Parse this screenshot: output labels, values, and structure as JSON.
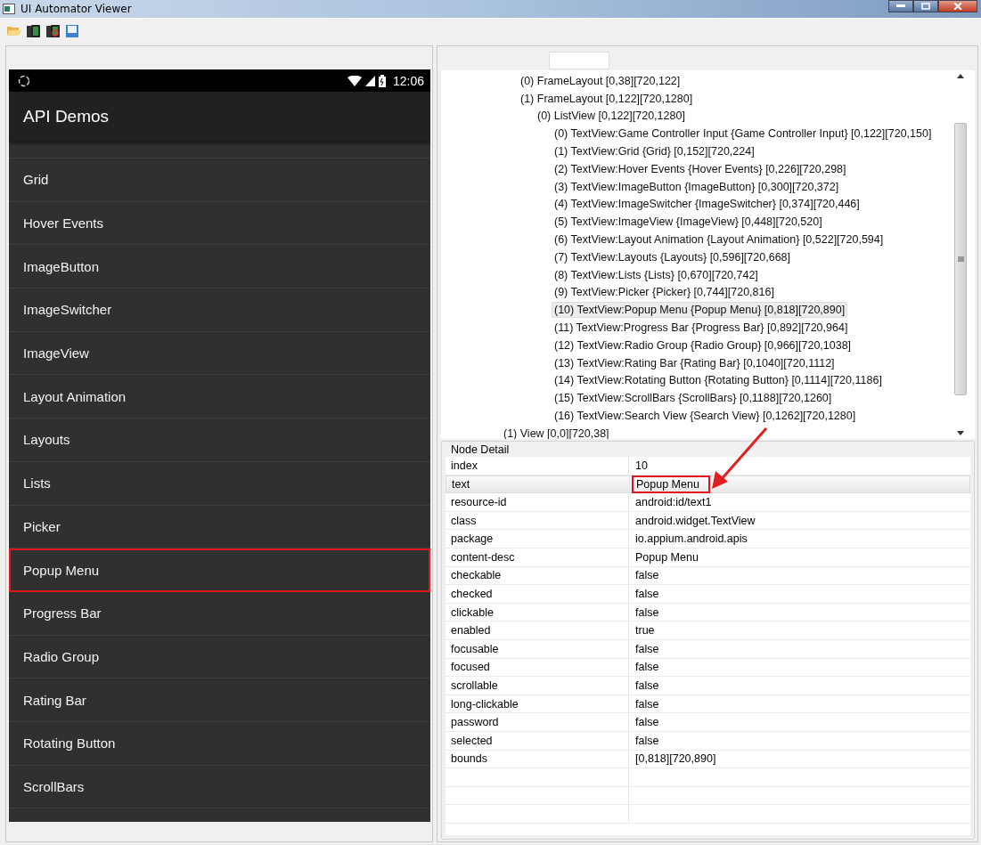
{
  "window": {
    "title": "UI Automator Viewer"
  },
  "device": {
    "time": "12:06",
    "app_title": "API Demos",
    "items": [
      {
        "label": "Grid",
        "selected": false
      },
      {
        "label": "Hover Events",
        "selected": false
      },
      {
        "label": "ImageButton",
        "selected": false
      },
      {
        "label": "ImageSwitcher",
        "selected": false
      },
      {
        "label": "ImageView",
        "selected": false
      },
      {
        "label": "Layout Animation",
        "selected": false
      },
      {
        "label": "Layouts",
        "selected": false
      },
      {
        "label": "Lists",
        "selected": false
      },
      {
        "label": "Picker",
        "selected": false
      },
      {
        "label": "Popup Menu",
        "selected": true
      },
      {
        "label": "Progress Bar",
        "selected": false
      },
      {
        "label": "Radio Group",
        "selected": false
      },
      {
        "label": "Rating Bar",
        "selected": false
      },
      {
        "label": "Rotating Button",
        "selected": false
      },
      {
        "label": "ScrollBars",
        "selected": false
      }
    ]
  },
  "tree": [
    {
      "children": [
        {
          "label": "(0) FrameLayout [0,38][720,122]",
          "selected": false
        },
        {
          "label": "(1) FrameLayout [0,122][720,1280]",
          "selected": false,
          "children": [
            {
              "label": "(0) ListView [0,122][720,1280]",
              "selected": false,
              "children": [
                {
                  "label": "(0) TextView:Game Controller Input {Game Controller Input} [0,122][720,150]",
                  "selected": false
                },
                {
                  "label": "(1) TextView:Grid {Grid} [0,152][720,224]",
                  "selected": false
                },
                {
                  "label": "(2) TextView:Hover Events {Hover Events} [0,226][720,298]",
                  "selected": false
                },
                {
                  "label": "(3) TextView:ImageButton {ImageButton} [0,300][720,372]",
                  "selected": false
                },
                {
                  "label": "(4) TextView:ImageSwitcher {ImageSwitcher} [0,374][720,446]",
                  "selected": false
                },
                {
                  "label": "(5) TextView:ImageView {ImageView} [0,448][720,520]",
                  "selected": false
                },
                {
                  "label": "(6) TextView:Layout Animation {Layout Animation} [0,522][720,594]",
                  "selected": false
                },
                {
                  "label": "(7) TextView:Layouts {Layouts} [0,596][720,668]",
                  "selected": false
                },
                {
                  "label": "(8) TextView:Lists {Lists} [0,670][720,742]",
                  "selected": false
                },
                {
                  "label": "(9) TextView:Picker {Picker} [0,744][720,816]",
                  "selected": false
                },
                {
                  "label": "(10) TextView:Popup Menu {Popup Menu} [0,818][720,890]",
                  "selected": true
                },
                {
                  "label": "(11) TextView:Progress Bar {Progress Bar} [0,892][720,964]",
                  "selected": false
                },
                {
                  "label": "(12) TextView:Radio Group {Radio Group} [0,966][720,1038]",
                  "selected": false
                },
                {
                  "label": "(13) TextView:Rating Bar {Rating Bar} [0,1040][720,1112]",
                  "selected": false
                },
                {
                  "label": "(14) TextView:Rotating Button {Rotating Button} [0,1114][720,1186]",
                  "selected": false
                },
                {
                  "label": "(15) TextView:ScrollBars {ScrollBars} [0,1188][720,1260]",
                  "selected": false
                },
                {
                  "label": "(16) TextView:Search View {Search View} [0,1262][720,1280]",
                  "selected": false
                }
              ]
            }
          ]
        }
      ]
    },
    {
      "label": "(1) View [0,0][720,38]",
      "selected": false
    }
  ],
  "node_detail": {
    "title": "Node Detail",
    "rows": [
      {
        "key": "index",
        "value": "10",
        "selected": false
      },
      {
        "key": "text",
        "value": "Popup Menu",
        "selected": true
      },
      {
        "key": "resource-id",
        "value": "android:id/text1",
        "selected": false
      },
      {
        "key": "class",
        "value": "android.widget.TextView",
        "selected": false
      },
      {
        "key": "package",
        "value": "io.appium.android.apis",
        "selected": false
      },
      {
        "key": "content-desc",
        "value": "Popup Menu",
        "selected": false
      },
      {
        "key": "checkable",
        "value": "false",
        "selected": false
      },
      {
        "key": "checked",
        "value": "false",
        "selected": false
      },
      {
        "key": "clickable",
        "value": "false",
        "selected": false
      },
      {
        "key": "enabled",
        "value": "true",
        "selected": false
      },
      {
        "key": "focusable",
        "value": "false",
        "selected": false
      },
      {
        "key": "focused",
        "value": "false",
        "selected": false
      },
      {
        "key": "scrollable",
        "value": "false",
        "selected": false
      },
      {
        "key": "long-clickable",
        "value": "false",
        "selected": false
      },
      {
        "key": "password",
        "value": "false",
        "selected": false
      },
      {
        "key": "selected",
        "value": "false",
        "selected": false
      },
      {
        "key": "bounds",
        "value": "[0,818][720,890]",
        "selected": false
      }
    ]
  }
}
